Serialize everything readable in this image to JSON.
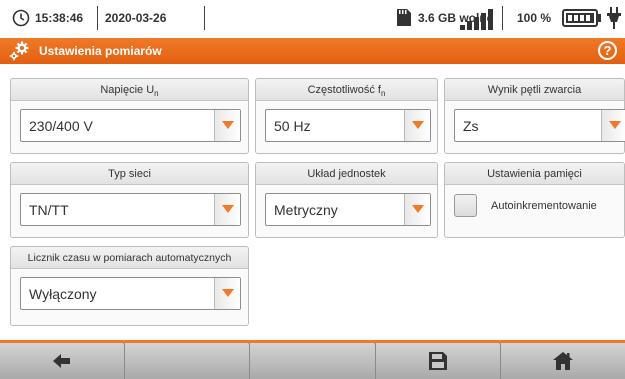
{
  "status": {
    "time": "15:38:46",
    "date": "2020-03-26",
    "memory": "3.6 GB wolne",
    "battery_percent": "100 %",
    "icons": [
      "clock-icon",
      "sd-card-icon",
      "signal-icon",
      "battery-icon",
      "plug-icon"
    ]
  },
  "header": {
    "title": "Ustawienia pomiarów",
    "icon": "settings-gears-icon",
    "help": "?"
  },
  "panels": [
    {
      "label": "Napięcie U",
      "sub": "n",
      "value": "230/400 V"
    },
    {
      "label": "Częstotliwość f",
      "sub": "n",
      "value": "50 Hz"
    },
    {
      "label": "Wynik pętli zwarcia",
      "value": "Zs"
    },
    {
      "label": "Typ sieci",
      "value": "TN/TT"
    },
    {
      "label": "Układ jednostek",
      "value": "Metryczny"
    },
    {
      "label": "Ustawienia pamięci",
      "checkbox_label": "Autoinkrementowanie",
      "checked": false
    },
    {
      "label": "Licznik czasu w pomiarach automatycznych",
      "value": "Wyłączony"
    }
  ],
  "toolbar": {
    "buttons": [
      "back-arrow-icon",
      "",
      "",
      "",
      "save-icon",
      "home-icon"
    ]
  },
  "colors": {
    "accent": "#f07a28",
    "dropdown_arrow": "#f07a28"
  }
}
